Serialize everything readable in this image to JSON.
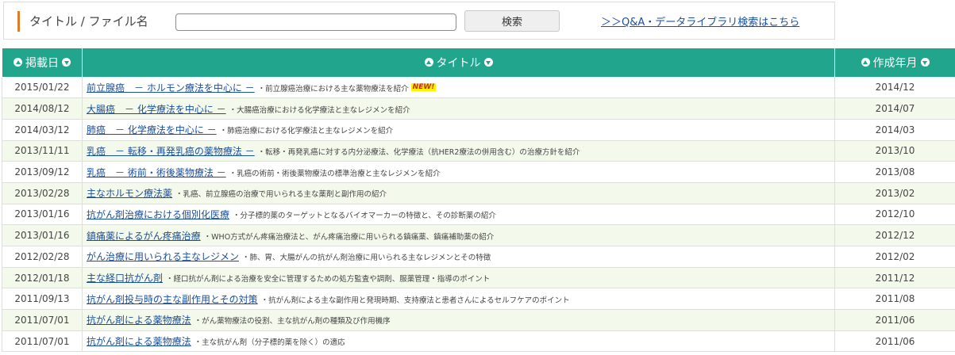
{
  "search": {
    "label": "タイトル / ファイル名",
    "value": "",
    "placeholder": "",
    "button_label": "検索",
    "qa_link": "＞＞Q&A・データライブラリ検索はこちら"
  },
  "table": {
    "headers": {
      "date": "掲載日",
      "title": "タイトル",
      "made": "作成年月"
    },
    "new_badge": "NEW!",
    "rows": [
      {
        "date": "2015/01/22",
        "title": "前立腺癌　－ ホルモン療法を中心に －",
        "desc": "・前立腺癌治療における主な薬物療法を紹介",
        "made": "2014/12",
        "is_new": true
      },
      {
        "date": "2014/08/12",
        "title": "大腸癌　－ 化学療法を中心に －",
        "desc": "・大腸癌治療における化学療法と主なレジメンを紹介",
        "made": "2014/07"
      },
      {
        "date": "2014/03/12",
        "title": "肺癌　－ 化学療法を中心に －",
        "desc": "・肺癌治療における化学療法と主なレジメンを紹介",
        "made": "2014/03"
      },
      {
        "date": "2013/11/11",
        "title": "乳癌　－ 転移・再発乳癌の薬物療法 －",
        "desc": "・転移・再発乳癌に対する内分泌療法、化学療法（抗HER2療法の併用含む）の治療方針を紹介",
        "made": "2013/10"
      },
      {
        "date": "2013/09/12",
        "title": "乳癌　－ 術前・術後薬物療法 －",
        "desc": "・乳癌の術前・術後薬物療法の標準治療と主なレジメンを紹介",
        "made": "2013/08"
      },
      {
        "date": "2013/02/28",
        "title": "主なホルモン療法薬",
        "desc": "・乳癌、前立腺癌の治療で用いられる主な薬剤と副作用の紹介",
        "made": "2013/02"
      },
      {
        "date": "2013/01/16",
        "title": "抗がん剤治療における個別化医療",
        "desc": "・分子標的薬のターゲットとなるバイオマーカーの特徴と、その診断薬の紹介",
        "made": "2012/10"
      },
      {
        "date": "2013/01/16",
        "title": "鎮痛薬によるがん疼痛治療",
        "desc": "・WHO方式がん疼痛治療法と、がん疼痛治療に用いられる鎮痛薬、鎮痛補助薬の紹介",
        "made": "2012/12"
      },
      {
        "date": "2012/02/28",
        "title": "がん治療に用いられる主なレジメン",
        "desc": "・肺、胃、大腸がんの抗がん剤治療に用いられる主なレジメンとその特徴",
        "made": "2012/02"
      },
      {
        "date": "2012/01/18",
        "title": "主な経口抗がん剤",
        "desc": "・経口抗がん剤による治療を安全に管理するための処方監査や調剤、服薬管理・指導のポイント",
        "made": "2011/12"
      },
      {
        "date": "2011/09/13",
        "title": "抗がん剤投与時の主な副作用とその対策",
        "desc": "・抗がん剤による主な副作用と発現時期、支持療法と患者さんによるセルフケアのポイント",
        "made": "2011/08"
      },
      {
        "date": "2011/07/01",
        "title": "抗がん剤による薬物療法",
        "desc": "・がん薬物療法の役割、主な抗がん剤の種類及び作用機序",
        "made": "2011/06"
      },
      {
        "date": "2011/07/01",
        "title": "抗がん剤による薬物療法",
        "desc": "・主な抗がん剤（分子標的薬を除く）の適応",
        "made": "2011/06"
      }
    ]
  },
  "colors": {
    "header_bg": "#21a58c",
    "row_alt_bg": "#f3faec",
    "link": "#1a4f9c",
    "label_accent": "#e07b2a"
  }
}
